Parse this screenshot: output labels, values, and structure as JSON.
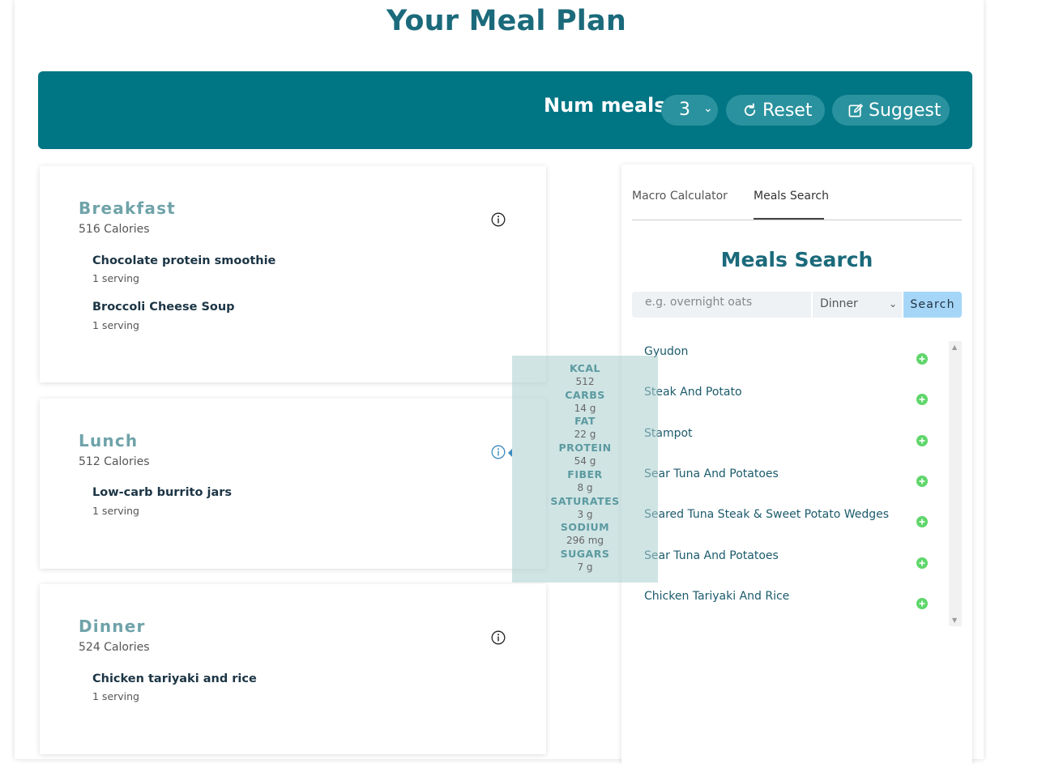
{
  "page": {
    "title": "Your Meal Plan"
  },
  "toolbar": {
    "num_meals_label": "Num meals:",
    "num_meals_value": "3",
    "reset_label": "Reset",
    "suggest_label": "Suggest",
    "bg_color": "#007584"
  },
  "meals": [
    {
      "name": "Breakfast",
      "calories": "516 Calories",
      "foods": [
        {
          "name": "Chocolate protein smoothie",
          "serving": "1 serving"
        },
        {
          "name": "Broccoli Cheese Soup",
          "serving": "1 serving"
        }
      ]
    },
    {
      "name": "Lunch",
      "calories": "512 Calories",
      "foods": [
        {
          "name": "Low-carb burrito jars",
          "serving": "1 serving"
        }
      ]
    },
    {
      "name": "Dinner",
      "calories": "524 Calories",
      "foods": [
        {
          "name": "Chicken tariyaki and rice",
          "serving": "1 serving"
        }
      ]
    }
  ],
  "nutrition_popover": {
    "items": [
      {
        "label": "KCAL",
        "value": "512"
      },
      {
        "label": "CARBS",
        "value": "14 g"
      },
      {
        "label": "FAT",
        "value": "22 g"
      },
      {
        "label": "PROTEIN",
        "value": "54 g"
      },
      {
        "label": "FIBER",
        "value": "8 g"
      },
      {
        "label": "SATURATES",
        "value": "3 g"
      },
      {
        "label": "SODIUM",
        "value": "296 mg"
      },
      {
        "label": "SUGARS",
        "value": "7 g"
      }
    ]
  },
  "side_panel": {
    "tabs": [
      {
        "label": "Macro Calculator",
        "active": false
      },
      {
        "label": "Meals Search",
        "active": true
      }
    ],
    "title": "Meals Search",
    "search_placeholder": "e.g. overnight oats",
    "meal_type_selected": "Dinner",
    "search_button": "Search",
    "results": [
      "Gyudon",
      "Steak And Potato",
      "Stampot",
      "Sear Tuna And Potatoes",
      "Seared Tuna Steak & Sweet Potato Wedges",
      "Sear Tuna And Potatoes",
      "Chicken Tariyaki And Rice"
    ],
    "add_icon_color": "#5fd66a"
  }
}
